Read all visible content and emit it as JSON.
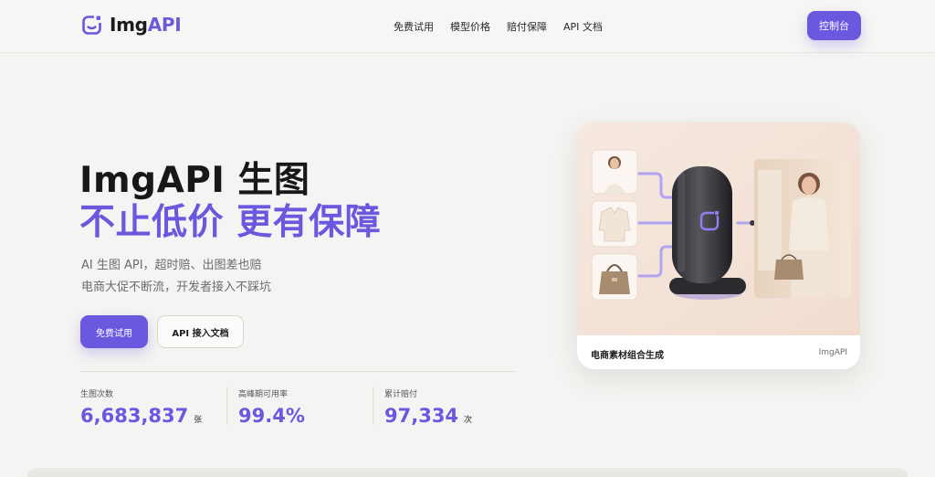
{
  "header": {
    "logo_text_a": "Img",
    "logo_text_b": "API",
    "nav": [
      "免费试用",
      "模型价格",
      "赔付保障",
      "API 文档"
    ],
    "console_label": "控制台"
  },
  "hero": {
    "title_line1": "ImgAPI 生图",
    "title_line2": "不止低价 更有保障",
    "sub_line1": "AI 生图 API，超时赔、出图差也赔",
    "sub_line2": "电商大促不断流，开发者接入不踩坑",
    "primary_btn": "免费试用",
    "secondary_btn": "API 接入文档"
  },
  "stats": [
    {
      "label": "生图次数",
      "value": "6,683,837",
      "unit": "张"
    },
    {
      "label": "高峰期可用率",
      "value": "99.4%",
      "unit": ""
    },
    {
      "label": "累计赔付",
      "value": "97,334",
      "unit": "次"
    }
  ],
  "showcase": {
    "caption": "电商素材组合生成",
    "brand": "ImgAPI"
  },
  "colors": {
    "accent": "#6a58de",
    "background": "#f5f4f2",
    "text": "#1c1c1e"
  },
  "icons": [
    "imgapi-logo-icon",
    "ai-device-icon"
  ]
}
